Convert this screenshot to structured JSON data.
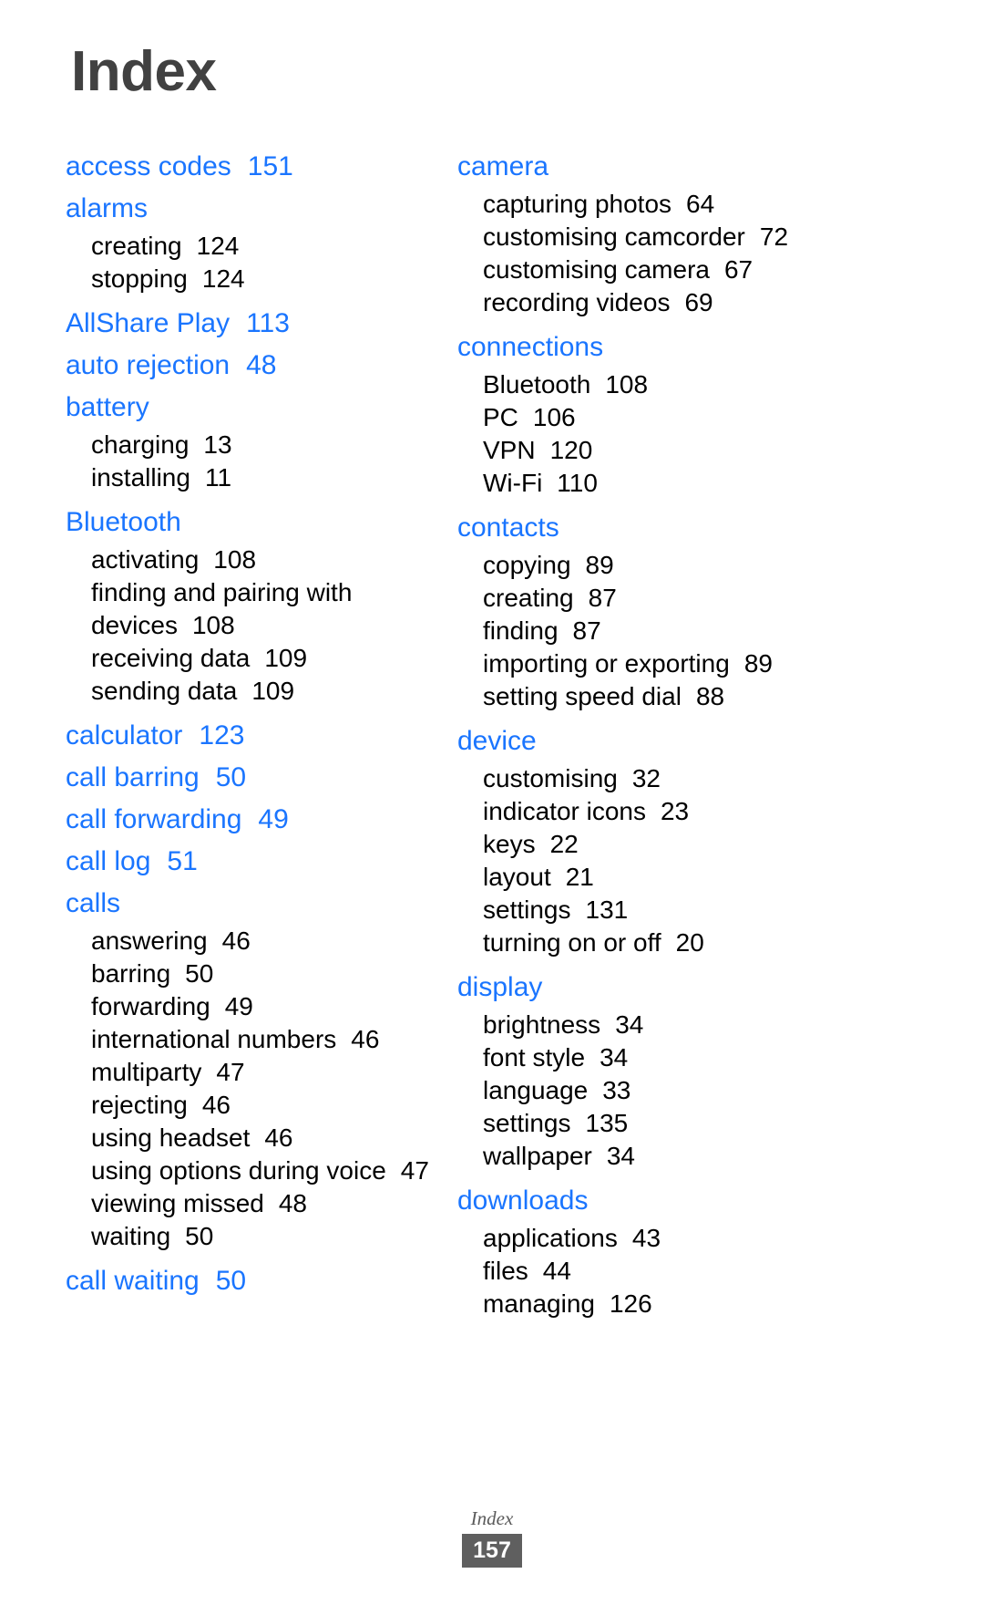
{
  "page_title": "Index",
  "colors": {
    "heading_blue": "#1a75ff",
    "title_gray": "#414141",
    "body_black": "#000000",
    "footer_badge_bg": "#5f5f5f"
  },
  "columns": {
    "left": [
      {
        "term": "access codes",
        "page": "151",
        "subentries": []
      },
      {
        "term": "alarms",
        "page": "",
        "subentries": [
          {
            "term": "creating",
            "page": "124"
          },
          {
            "term": "stopping",
            "page": "124"
          }
        ]
      },
      {
        "term": "AllShare Play",
        "page": "113",
        "subentries": []
      },
      {
        "term": "auto rejection",
        "page": "48",
        "subentries": []
      },
      {
        "term": "battery",
        "page": "",
        "subentries": [
          {
            "term": "charging",
            "page": "13"
          },
          {
            "term": "installing",
            "page": "11"
          }
        ]
      },
      {
        "term": "Bluetooth",
        "page": "",
        "subentries": [
          {
            "term": "activating",
            "page": "108"
          },
          {
            "term": "finding and pairing with devices",
            "page": "108"
          },
          {
            "term": "receiving data",
            "page": "109"
          },
          {
            "term": "sending data",
            "page": "109"
          }
        ]
      },
      {
        "term": "calculator",
        "page": "123",
        "subentries": []
      },
      {
        "term": "call barring",
        "page": "50",
        "subentries": []
      },
      {
        "term": "call forwarding",
        "page": "49",
        "subentries": []
      },
      {
        "term": "call log",
        "page": "51",
        "subentries": []
      },
      {
        "term": "calls",
        "page": "",
        "subentries": [
          {
            "term": "answering",
            "page": "46"
          },
          {
            "term": "barring",
            "page": "50"
          },
          {
            "term": "forwarding",
            "page": "49"
          },
          {
            "term": "international numbers",
            "page": "46"
          },
          {
            "term": "multiparty",
            "page": "47"
          },
          {
            "term": "rejecting",
            "page": "46"
          },
          {
            "term": "using headset",
            "page": "46"
          },
          {
            "term": "using options during voice",
            "page": "47"
          },
          {
            "term": "viewing missed",
            "page": "48"
          },
          {
            "term": "waiting",
            "page": "50"
          }
        ]
      },
      {
        "term": "call waiting",
        "page": "50",
        "subentries": []
      }
    ],
    "right": [
      {
        "term": "camera",
        "page": "",
        "subentries": [
          {
            "term": "capturing photos",
            "page": "64"
          },
          {
            "term": "customising camcorder",
            "page": "72"
          },
          {
            "term": "customising camera",
            "page": "67"
          },
          {
            "term": "recording videos",
            "page": "69"
          }
        ]
      },
      {
        "term": "connections",
        "page": "",
        "subentries": [
          {
            "term": "Bluetooth",
            "page": "108"
          },
          {
            "term": "PC",
            "page": "106"
          },
          {
            "term": "VPN",
            "page": "120"
          },
          {
            "term": "Wi-Fi",
            "page": "110"
          }
        ]
      },
      {
        "term": "contacts",
        "page": "",
        "subentries": [
          {
            "term": "copying",
            "page": "89"
          },
          {
            "term": "creating",
            "page": "87"
          },
          {
            "term": "finding",
            "page": "87"
          },
          {
            "term": "importing or exporting",
            "page": "89"
          },
          {
            "term": "setting speed dial",
            "page": "88"
          }
        ]
      },
      {
        "term": "device",
        "page": "",
        "subentries": [
          {
            "term": "customising",
            "page": "32"
          },
          {
            "term": "indicator icons",
            "page": "23"
          },
          {
            "term": "keys",
            "page": "22"
          },
          {
            "term": "layout",
            "page": "21"
          },
          {
            "term": "settings",
            "page": "131"
          },
          {
            "term": "turning on or off",
            "page": "20"
          }
        ]
      },
      {
        "term": "display",
        "page": "",
        "subentries": [
          {
            "term": "brightness",
            "page": "34"
          },
          {
            "term": "font style",
            "page": "34"
          },
          {
            "term": "language",
            "page": "33"
          },
          {
            "term": "settings",
            "page": "135"
          },
          {
            "term": "wallpaper",
            "page": "34"
          }
        ]
      },
      {
        "term": "downloads",
        "page": "",
        "subentries": [
          {
            "term": "applications",
            "page": "43"
          },
          {
            "term": "files",
            "page": "44"
          },
          {
            "term": "managing",
            "page": "126"
          }
        ]
      }
    ]
  },
  "footer": {
    "label": "Index",
    "page_number": "157"
  }
}
